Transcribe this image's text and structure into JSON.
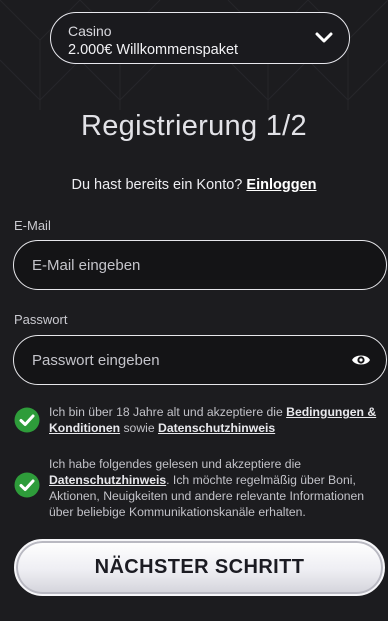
{
  "bonus": {
    "category": "Casino",
    "value": "2.000€ Willkommenspaket",
    "icon": "chevron-down-icon"
  },
  "header": {
    "title": "Registrierung 1/2"
  },
  "login": {
    "prompt": "Du hast bereits ein Konto?",
    "link": "Einloggen"
  },
  "email": {
    "label": "E-Mail",
    "placeholder": "E-Mail eingeben",
    "value": ""
  },
  "password": {
    "label": "Passwort",
    "placeholder": "Passwort eingeben",
    "value": "",
    "icon": "eye-icon"
  },
  "consents": [
    {
      "checked": true,
      "text_1": "Ich bin über 18 Jahre alt und akzeptiere die ",
      "link_1": "Bedingungen & Konditionen",
      "text_2": " sowie ",
      "link_2": "Datenschutzhinweis"
    },
    {
      "checked": true,
      "text_1": "Ich habe folgendes gelesen und akzeptiere die ",
      "link_1": "Datenschutzhinweis",
      "text_2": ". Ich möchte regelmäßig über Boni, Aktionen, Neuigkeiten und andere relevante Informationen über beliebige Kommunikationskanäle erhalten."
    }
  ],
  "actions": {
    "next_label": "NÄCHSTER SCHRITT"
  },
  "colors": {
    "background": "#1c1c1f",
    "check_green": "#2e9c3a",
    "button_gradient_top": "#ffffff",
    "button_gradient_bottom": "#d3d3da"
  }
}
